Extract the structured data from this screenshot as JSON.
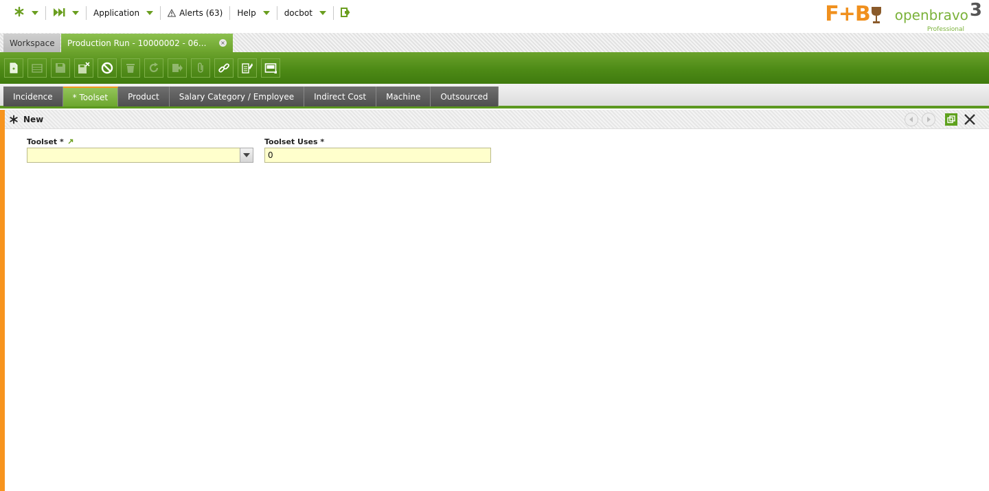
{
  "nav": {
    "application_label": "Application",
    "alerts_label": "Alerts (63)",
    "help_label": "Help",
    "user_label": "docbot"
  },
  "brand": {
    "client_logo_text": "F+B",
    "product_logo_text": "openbravo",
    "product_version": "3",
    "product_edition": "Professional"
  },
  "window_tabs": [
    {
      "label": "Workspace",
      "active": false
    },
    {
      "label": "Production Run - 10000002 - 06...",
      "active": true,
      "close_label": "×"
    }
  ],
  "toolbar": {
    "buttons": [
      {
        "icon": "new-document-icon",
        "enabled": true
      },
      {
        "icon": "grid-icon",
        "enabled": false
      },
      {
        "icon": "save-icon",
        "enabled": false
      },
      {
        "icon": "save-close-icon",
        "enabled": true
      },
      {
        "icon": "undo-icon",
        "enabled": true
      },
      {
        "icon": "delete-icon",
        "enabled": false
      },
      {
        "icon": "refresh-icon",
        "enabled": false
      },
      {
        "icon": "export-icon",
        "enabled": false
      },
      {
        "icon": "attach-icon",
        "enabled": false
      },
      {
        "icon": "link-icon",
        "enabled": true
      },
      {
        "icon": "process-icon",
        "enabled": true
      },
      {
        "icon": "tab-layout-icon",
        "enabled": true
      }
    ]
  },
  "sub_tabs": [
    {
      "label": "Incidence",
      "active": false
    },
    {
      "label": "* Toolset",
      "active": true
    },
    {
      "label": "Product",
      "active": false
    },
    {
      "label": "Salary Category / Employee",
      "active": false
    },
    {
      "label": "Indirect Cost",
      "active": false
    },
    {
      "label": "Machine",
      "active": false
    },
    {
      "label": "Outsourced",
      "active": false
    }
  ],
  "form": {
    "header_title": "New",
    "fields": {
      "toolset": {
        "label": "Toolset *",
        "value": ""
      },
      "toolset_uses": {
        "label": "Toolset Uses *",
        "value": "0"
      }
    }
  },
  "colors": {
    "accent_green": "#5b981f",
    "accent_orange": "#f7941e",
    "required_field_bg": "#ffffcc"
  }
}
